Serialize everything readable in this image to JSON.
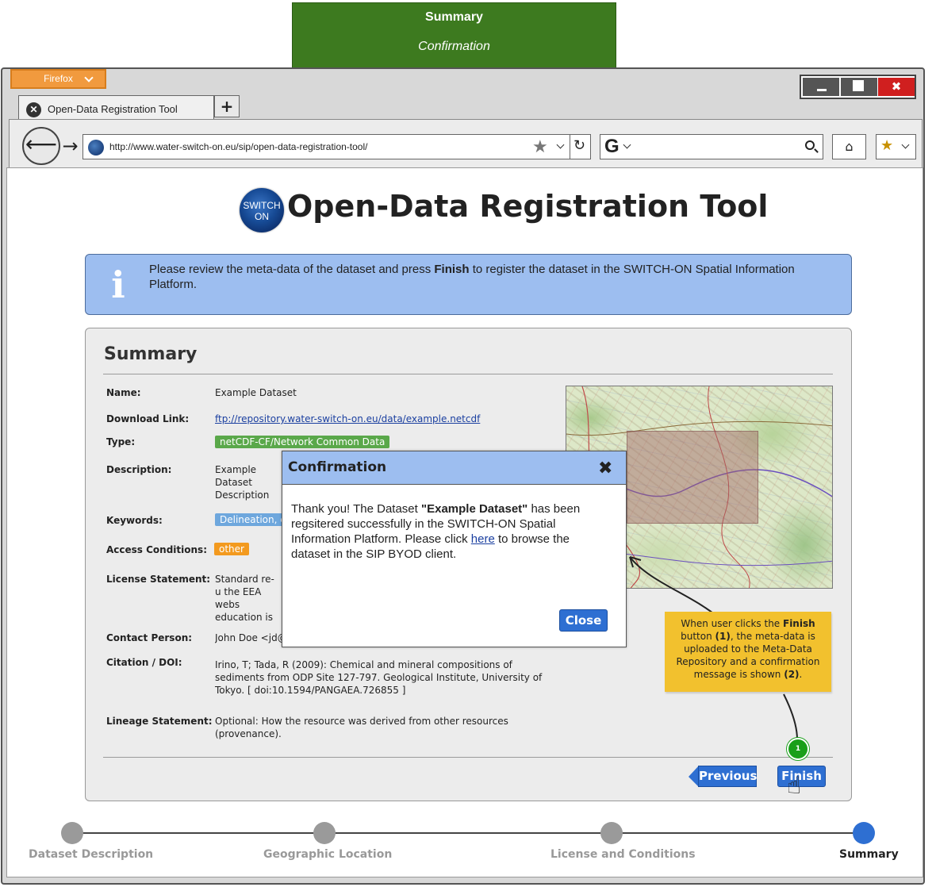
{
  "banner": {
    "line1": "Summary",
    "line2": "Confirmation"
  },
  "browser": {
    "menu_label": "Firefox",
    "tab_title": "Open-Data Registration Tool",
    "new_tab_label": "+",
    "url": "http://www.water-switch-on.eu/sip/open-data-registration-tool/",
    "window_close_label": "✖"
  },
  "page": {
    "logo_line1": "SWITCH",
    "logo_line2": "ON",
    "title": "Open-Data Registration Tool",
    "info_prefix": "Please review the meta-data of the dataset and press ",
    "info_bold": "Finish",
    "info_suffix": " to register the dataset in the SWITCH-ON Spatial Information Platform."
  },
  "summary": {
    "title": "Summary",
    "fields": {
      "name": {
        "label": "Name:",
        "value": "Example Dataset"
      },
      "download": {
        "label": "Download Link:",
        "value": "ftp://repository.water-switch-on.eu/data/example.netcdf"
      },
      "type": {
        "label": "Type:",
        "value": "netCDF-CF/Network Common Data"
      },
      "description": {
        "label": "Description:",
        "value": "Example Dataset Description"
      },
      "keywords": {
        "label": "Keywords:",
        "value": "Delineation, c"
      },
      "access": {
        "label": "Access Conditions:",
        "value": "other"
      },
      "license": {
        "label": "License Statement:",
        "value": "Standard re-u the EEA webs education is p acknowledged"
      },
      "contact": {
        "label": "Contact Person:",
        "value": "John Doe <jd@"
      },
      "citation": {
        "label": "Citation / DOI:",
        "value": "Irino, T; Tada, R (2009): Chemical and mineral compositions of sediments from ODP Site 127-797. Geological Institute, University of Tokyo. [ doi:10.1594/PANGAEA.726855 ]"
      },
      "lineage": {
        "label": "Lineage Statement:",
        "value": "Optional: How the resource was derived from other resources (provenance)."
      }
    },
    "previous_label": "Previous",
    "finish_label": "Finish",
    "badge": "1"
  },
  "dialog": {
    "title": "Confirmation",
    "close_icon": "✖",
    "text_prefix": "Thank you! The Dataset ",
    "text_bold": "\"Example Dataset\"",
    "text_mid": " has been regsitered successfully in the SWITCH-ON Spatial Information Platform. Please click ",
    "text_link": "here",
    "text_suffix": " to browse the dataset in the SIP BYOD client.",
    "close_label": "Close"
  },
  "note": {
    "p1": "When user clicks the ",
    "b1": "Finish",
    "p2": " button ",
    "b2": "(1)",
    "p3": ", the meta-data is uploaded to the Meta-Data Repository and a confirmation message is shown ",
    "b3": "(2)",
    "p4": "."
  },
  "steps": [
    {
      "label": "Dataset Description",
      "active": false
    },
    {
      "label": "Geographic Location",
      "active": false
    },
    {
      "label": "License and Conditions",
      "active": false
    },
    {
      "label": "Summary",
      "active": true
    }
  ],
  "colors": {
    "banner": "#3d7a1f",
    "info_bg": "#9dbef0",
    "button_blue": "#2e6fd2",
    "tag_green": "#5aa84a",
    "tag_blue": "#6ea7dd",
    "tag_orange": "#f39a1f",
    "note_yellow": "#f2c12e",
    "step_active": "#2e6fd2",
    "step_inactive": "#9a9a9a"
  },
  "icons": {
    "tab_close": "close-circle-icon",
    "back": "back-arrow-icon",
    "forward": "forward-arrow-icon",
    "bookmark_star": "star-icon",
    "reload": "reload-icon",
    "search_engine": "google-icon",
    "search": "search-icon",
    "home": "home-icon",
    "bookmarks": "bookmarks-star-icon",
    "info": "info-icon",
    "cursor": "hand-pointer-icon"
  }
}
